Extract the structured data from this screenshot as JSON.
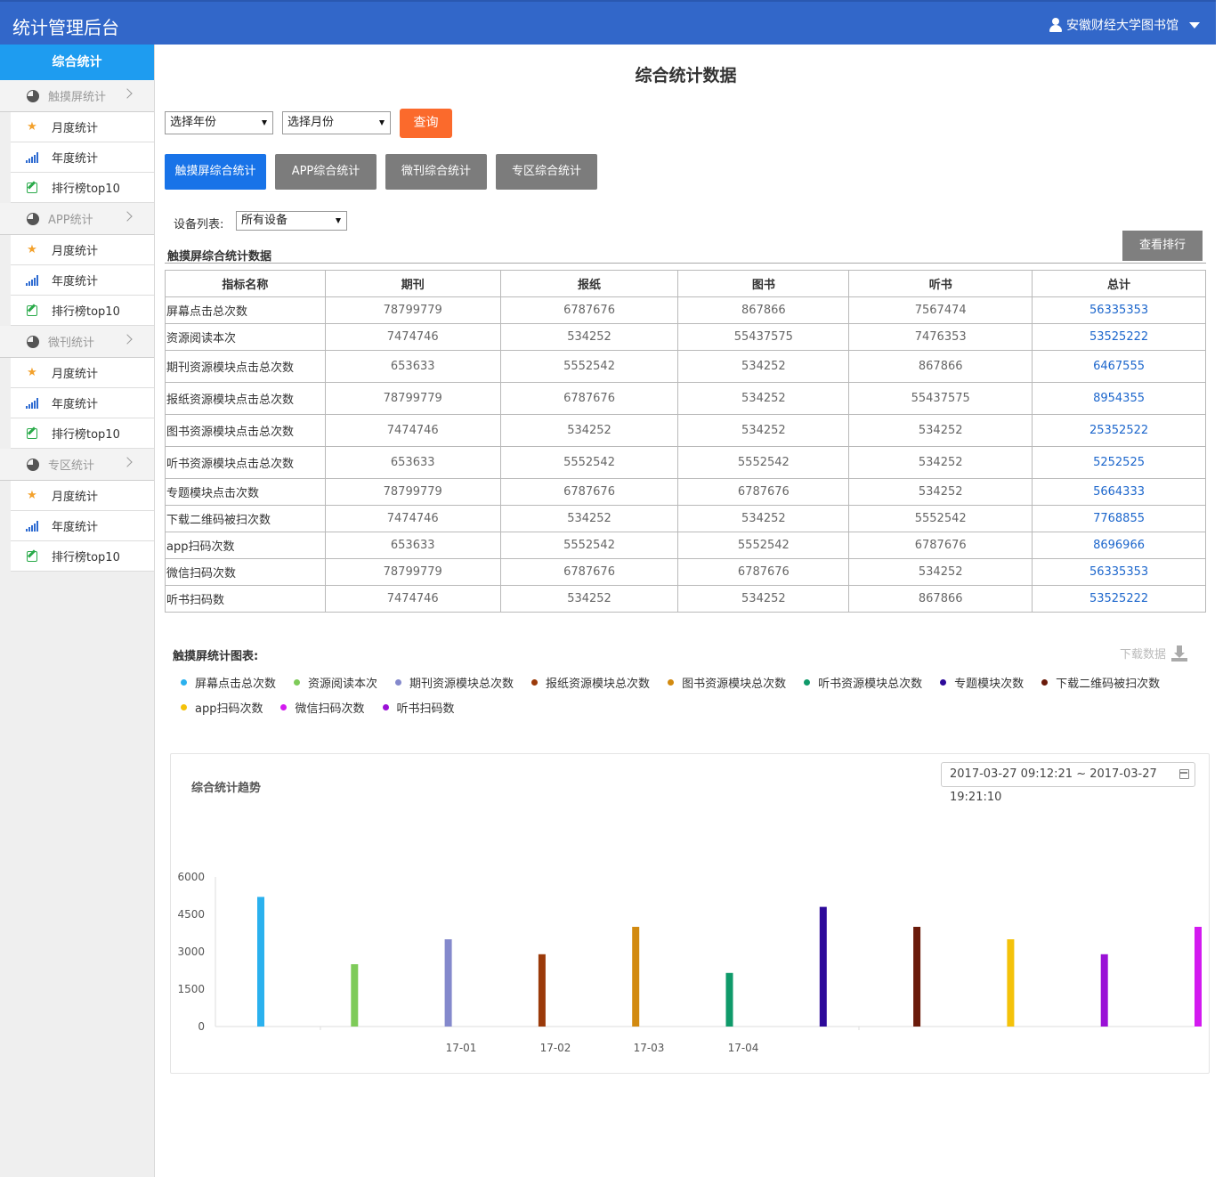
{
  "app": {
    "title": "统计管理后台",
    "user": "安徽财经大学图书馆"
  },
  "sidebar": {
    "head": "综合统计",
    "groups": [
      {
        "label": "触摸屏统计",
        "items": [
          "月度统计",
          "年度统计",
          "排行榜top10"
        ]
      },
      {
        "label": "APP统计",
        "items": [
          "月度统计",
          "年度统计",
          "排行榜top10"
        ]
      },
      {
        "label": "微刊统计",
        "items": [
          "月度统计",
          "年度统计",
          "排行榜top10"
        ]
      },
      {
        "label": "专区统计",
        "items": [
          "月度统计",
          "年度统计",
          "排行榜top10"
        ]
      }
    ]
  },
  "main": {
    "title": "综合统计数据",
    "year_select": "选择年份",
    "month_select": "选择月份",
    "query_label": "查询",
    "tabs": [
      "触摸屏综合统计",
      "APP综合统计",
      "微刊综合统计",
      "专区综合统计"
    ],
    "device_label": "设备列表:",
    "device_select": "所有设备",
    "rank_label": "查看排行",
    "section_title": "触摸屏综合统计数据",
    "table": {
      "headers": [
        "指标名称",
        "期刊",
        "报纸",
        "图书",
        "听书",
        "总计"
      ],
      "rows": [
        [
          "屏幕点击总次数",
          "78799779",
          "6787676",
          "867866",
          "7567474",
          "56335353"
        ],
        [
          "资源阅读本次",
          "7474746",
          "534252",
          "55437575",
          "7476353",
          "53525222"
        ],
        [
          "期刊资源模块点击总次数",
          "653633",
          "5552542",
          "534252",
          "867866",
          "6467555"
        ],
        [
          "报纸资源模块点击总次数",
          "78799779",
          "6787676",
          "534252",
          "55437575",
          "8954355"
        ],
        [
          "图书资源模块点击总次数",
          "7474746",
          "534252",
          "534252",
          "534252",
          "25352522"
        ],
        [
          "听书资源模块点击总次数",
          "653633",
          "5552542",
          "5552542",
          "534252",
          "5252525"
        ],
        [
          "专题模块点击次数",
          "78799779",
          "6787676",
          "6787676",
          "534252",
          "5664333"
        ],
        [
          "下载二维码被扫次数",
          "7474746",
          "534252",
          "534252",
          "5552542",
          "7768855"
        ],
        [
          "app扫码次数",
          "653633",
          "5552542",
          "5552542",
          "6787676",
          "8696966"
        ],
        [
          "微信扫码次数",
          "78799779",
          "6787676",
          "6787676",
          "534252",
          "56335353"
        ],
        [
          "听书扫码数",
          "7474746",
          "534252",
          "534252",
          "867866",
          "53525222"
        ]
      ]
    },
    "chart_section_title": "触摸屏统计图表:",
    "download_label": "下载数据",
    "legend": [
      {
        "name": "屏幕点击总次数",
        "color": "#2bb1ee"
      },
      {
        "name": "资源阅读本次",
        "color": "#7ecb59"
      },
      {
        "name": "期刊资源模块总次数",
        "color": "#8489cc"
      },
      {
        "name": "报纸资源模块总次数",
        "color": "#9b3a0a"
      },
      {
        "name": "图书资源模块总次数",
        "color": "#d28a10"
      },
      {
        "name": "听书资源模块总次数",
        "color": "#0f9a6a"
      },
      {
        "name": "专题模块次数",
        "color": "#2d0a9a"
      },
      {
        "name": "下载二维码被扫次数",
        "color": "#6a1a0a"
      },
      {
        "name": "app扫码次数",
        "color": "#f4c20a"
      },
      {
        "name": "微信扫码次数",
        "color": "#d31af0"
      },
      {
        "name": "听书扫码数",
        "color": "#9a11d6"
      }
    ],
    "panel_title": "综合统计趋势",
    "date_range": "2017-03-27 09:12:21 ~ 2017-03-27 19:21:10"
  },
  "chart_data": {
    "type": "bar",
    "title": "综合统计趋势",
    "ylim": [
      0,
      6000
    ],
    "yticks": [
      "0",
      "1500",
      "3000",
      "4500",
      "6000"
    ],
    "xtick_labels": [
      "17-01",
      "17-02",
      "17-03",
      "17-04"
    ],
    "grid": false,
    "bars": [
      {
        "value": 5200,
        "color": "#2bb1ee"
      },
      {
        "value": 2500,
        "color": "#7ecb59"
      },
      {
        "value": 3500,
        "color": "#8489cc"
      },
      {
        "value": 2900,
        "color": "#9b3a0a"
      },
      {
        "value": 4000,
        "color": "#d28a10"
      },
      {
        "value": 2150,
        "color": "#0f9a6a"
      },
      {
        "value": 4800,
        "color": "#2d0a9a"
      },
      {
        "value": 4000,
        "color": "#6a1a0a"
      },
      {
        "value": 3500,
        "color": "#f4c20a"
      },
      {
        "value": 2900,
        "color": "#9a11d6"
      },
      {
        "value": 4000,
        "color": "#d31af0"
      }
    ]
  }
}
